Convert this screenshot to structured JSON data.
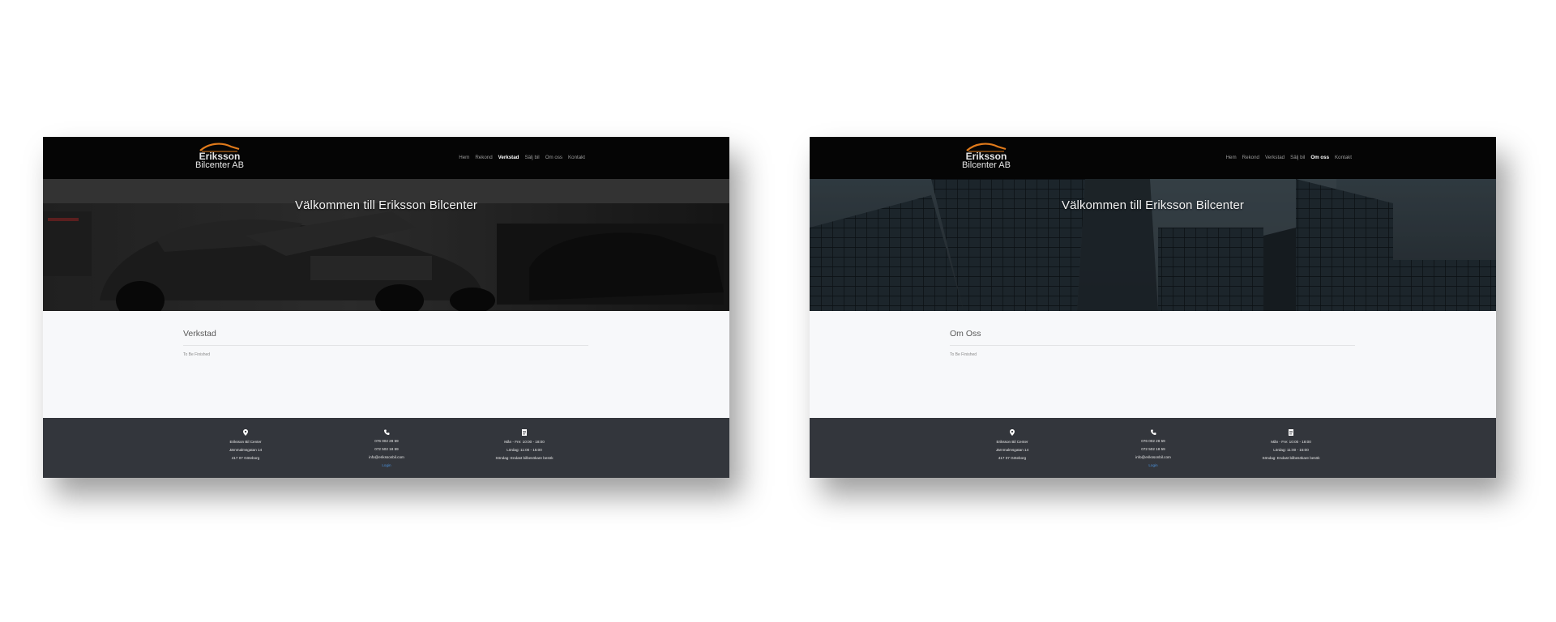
{
  "screens": [
    {
      "logo": {
        "line1": "Eriksson",
        "line2": "Bilcenter AB"
      },
      "nav": {
        "items": [
          "Hem",
          "Rekond",
          "Verkstad",
          "Sälj bil",
          "Om oss",
          "Kontakt"
        ],
        "active": "Verkstad"
      },
      "hero": {
        "title": "Välkommen till Eriksson Bilcenter",
        "background": "car-garage-photo"
      },
      "section": {
        "title": "Verkstad",
        "text": "To Be Finished"
      },
      "footer": {
        "address": [
          "Eriksson Bil Center",
          "Järnmalmsgatan 14",
          "417 07 Göteborg"
        ],
        "contact": [
          "076 002 28 59",
          "072 502 18 59",
          "info@erikssonbil.com"
        ],
        "login": "Login",
        "hours": [
          "Mån - Fre: 10:00 - 18:00",
          "Lördag: 11:00 - 15:00",
          "Söndag: Endast bilbesökare besök"
        ]
      }
    },
    {
      "logo": {
        "line1": "Eriksson",
        "line2": "Bilcenter AB"
      },
      "nav": {
        "items": [
          "Hem",
          "Rekond",
          "Verkstad",
          "Sälj bil",
          "Om oss",
          "Kontakt"
        ],
        "active": "Om oss"
      },
      "hero": {
        "title": "Välkommen till Eriksson Bilcenter",
        "background": "office-buildings-photo"
      },
      "section": {
        "title": "Om Oss",
        "text": "To Be Finished"
      },
      "footer": {
        "address": [
          "Eriksson Bil Center",
          "Järnmalmsgatan 14",
          "417 07 Göteborg"
        ],
        "contact": [
          "076 002 28 59",
          "072 502 18 59",
          "info@erikssonbil.com"
        ],
        "login": "Login",
        "hours": [
          "Mån - Fre: 10:00 - 18:00",
          "Lördag: 11:00 - 15:00",
          "Söndag: Endast bilbesökare besök"
        ]
      }
    }
  ],
  "colors": {
    "topbar": "#050505",
    "content_bg": "#f7f8fa",
    "footer_bg": "#33363c",
    "logo_accent": "#e07a1a",
    "link": "#4a90d9"
  }
}
